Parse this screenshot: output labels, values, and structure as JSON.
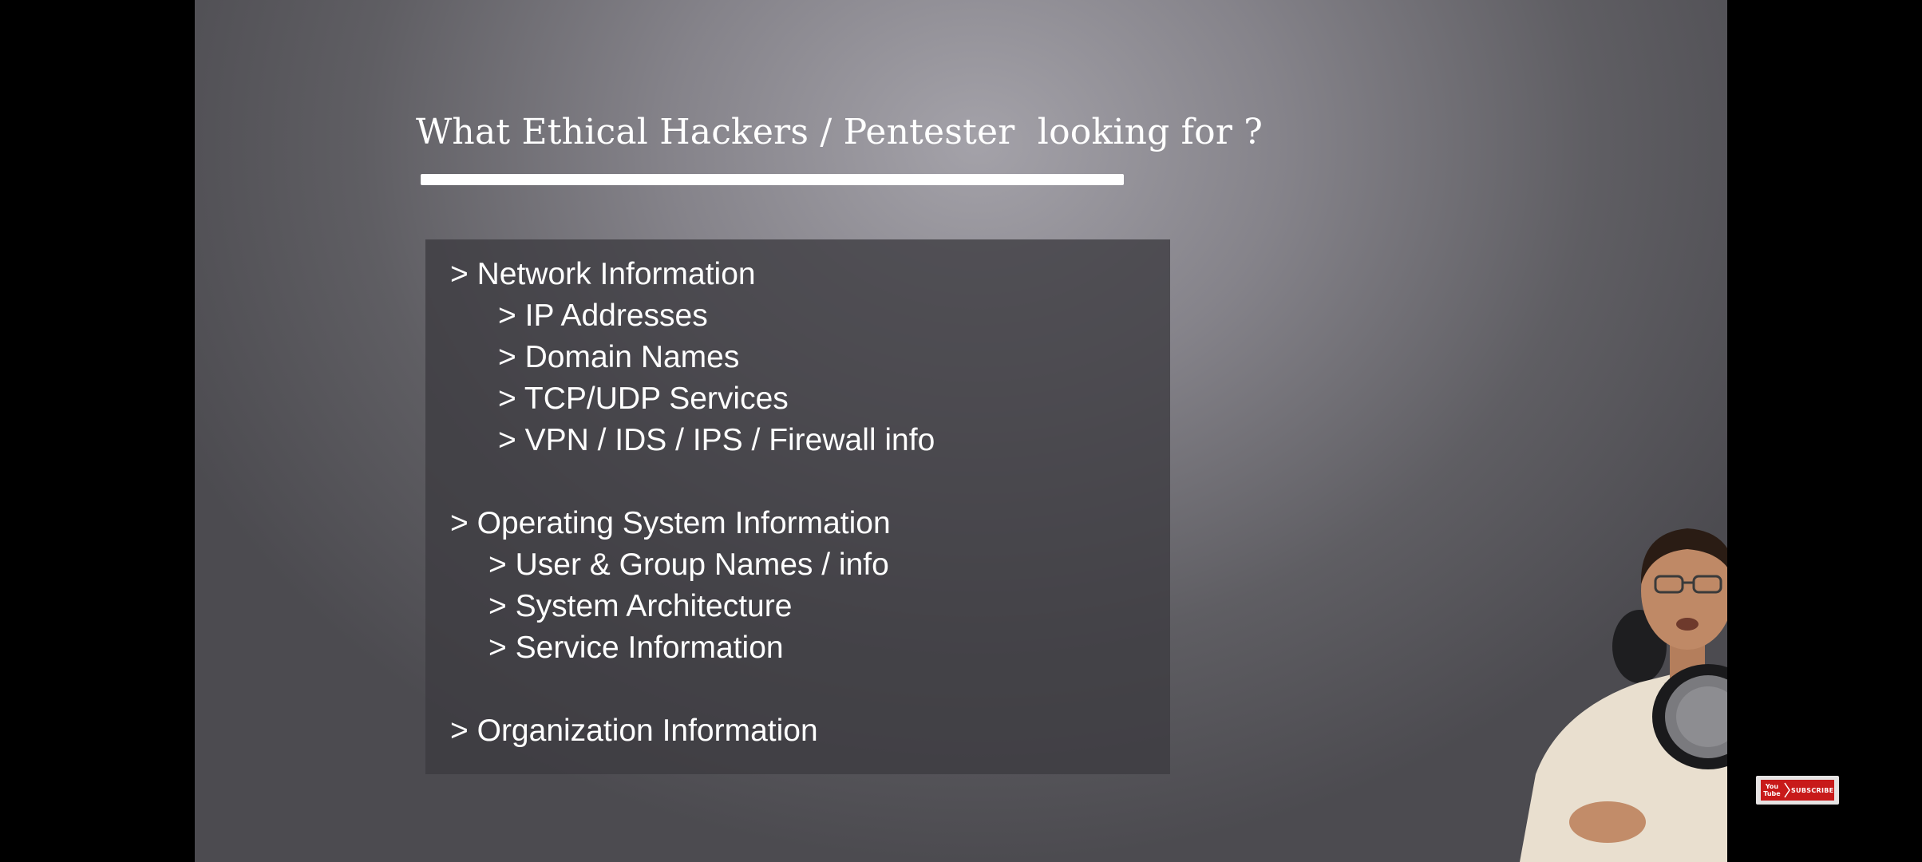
{
  "slide": {
    "title": "What Ethical Hackers / Pentester  looking for ?",
    "items": [
      "> Network Information",
      "> IP Addresses",
      "> Domain Names",
      "> TCP/UDP Services",
      "> VPN / IDS / IPS / Firewall info",
      "> Operating System Information",
      "> User & Group Names / info",
      "> System Architecture",
      "> Service Information",
      "> Organization Information"
    ]
  },
  "subscribe": {
    "logo_line1": "You",
    "logo_line2": "Tube",
    "label": "SUBSCRIBE",
    "color": "#c81a1a"
  },
  "colors": {
    "background_outer": "#000000",
    "slide_text": "#ffffff",
    "content_box": "#3c3b40"
  },
  "icons": {
    "subscribe": "youtube-logo-icon",
    "chevron": "chevron-right-icon",
    "presenter": "presenter-with-microphone"
  }
}
